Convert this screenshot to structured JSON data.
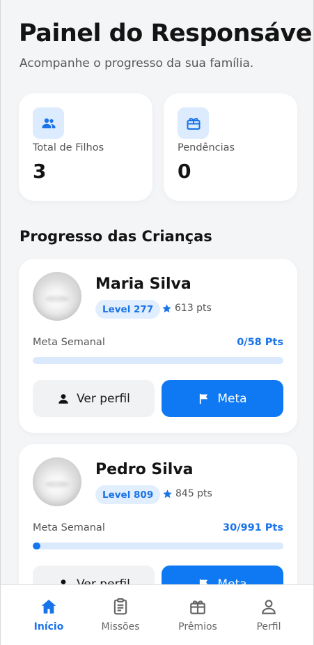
{
  "header": {
    "title": "Painel do Responsável",
    "subtitle": "Acompanhe o progresso da sua família."
  },
  "stats": [
    {
      "icon": "family-icon",
      "label": "Total de Filhos",
      "value": "3"
    },
    {
      "icon": "gift-icon",
      "label": "Pendências",
      "value": "0"
    }
  ],
  "section_title": "Progresso das Crianças",
  "children": [
    {
      "name": "Maria Silva",
      "level": "Level 277",
      "points": "613 pts",
      "meta_label": "Meta Semanal",
      "meta_value": "0/58 Pts",
      "progress": 0,
      "profile_button": "Ver perfil",
      "meta_button": "Meta"
    },
    {
      "name": "Pedro Silva",
      "level": "Level 809",
      "points": "845 pts",
      "meta_label": "Meta Semanal",
      "meta_value": "30/991 Pts",
      "progress": 0.03,
      "profile_button": "Ver perfil",
      "meta_button": "Meta"
    }
  ],
  "tabbar": [
    {
      "label": "Início",
      "icon": "home-icon",
      "active": true
    },
    {
      "label": "Missões",
      "icon": "clipboard-icon",
      "active": false
    },
    {
      "label": "Prêmios",
      "icon": "gift-icon",
      "active": false
    },
    {
      "label": "Perfil",
      "icon": "user-icon",
      "active": false
    }
  ],
  "colors": {
    "accent": "#1577f0",
    "accent_text": "#1a73e8",
    "badge_bg": "#e1eefd",
    "background": "#f4f5f7"
  }
}
